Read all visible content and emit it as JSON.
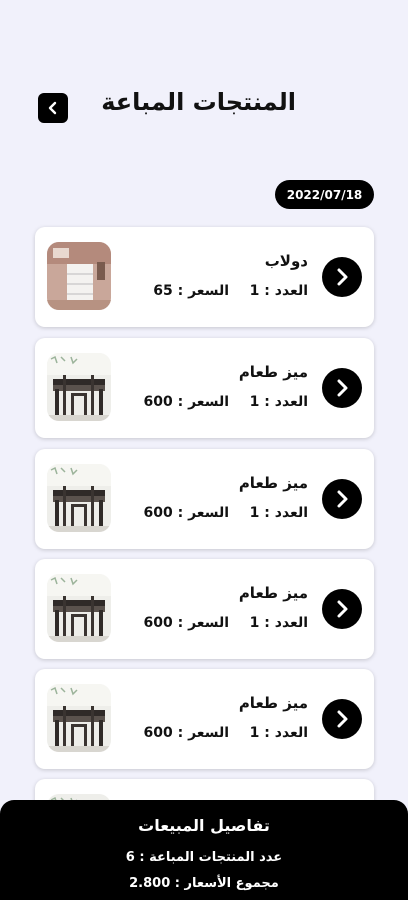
{
  "header": {
    "title": "المنتجات المباعة"
  },
  "date": "2022/07/18",
  "items": [
    {
      "name": "دولاب",
      "qty_label": "العدد : 1",
      "price_label": "السعر : 65",
      "image": "wardrobe-photo"
    },
    {
      "name": "ميز طعام",
      "qty_label": "العدد : 1",
      "price_label": "السعر : 600",
      "image": "dining-table-photo"
    },
    {
      "name": "ميز طعام",
      "qty_label": "العدد : 1",
      "price_label": "السعر : 600",
      "image": "dining-table-photo"
    },
    {
      "name": "ميز طعام",
      "qty_label": "العدد : 1",
      "price_label": "السعر : 600",
      "image": "dining-table-photo"
    },
    {
      "name": "ميز طعام",
      "qty_label": "العدد : 1",
      "price_label": "السعر : 600",
      "image": "dining-table-photo"
    }
  ],
  "summary": {
    "title": "تفاصيل المبيعات",
    "count_label": "عدد المنتجات المباعة : 6",
    "total_label": "مجموع الأسعار : 2.800"
  },
  "colors": {
    "background": "#f1f1fb",
    "accent": "#000000",
    "card": "#ffffff"
  },
  "icons": {
    "back": "chevron-left-icon",
    "item_action": "chevron-right-icon"
  }
}
